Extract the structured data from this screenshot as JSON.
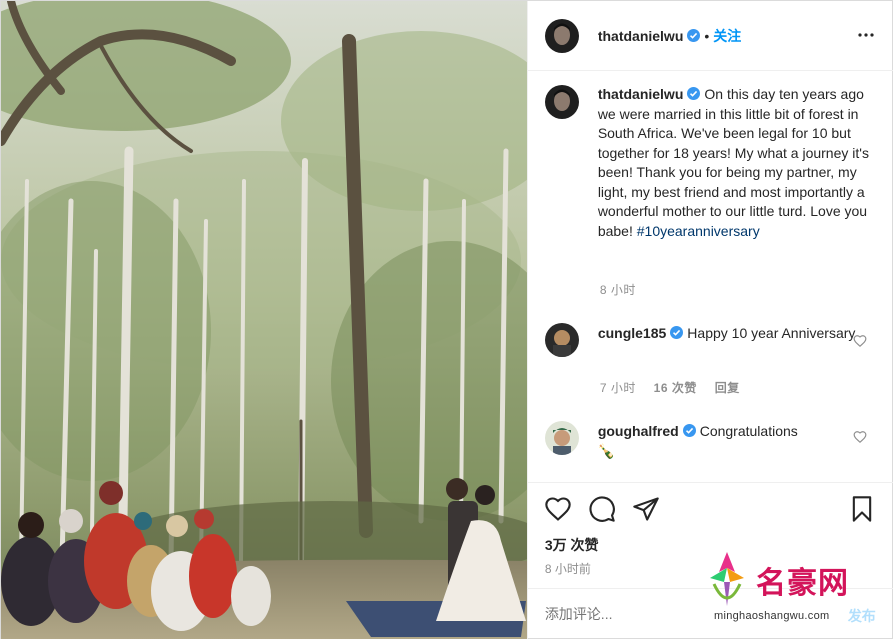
{
  "header": {
    "username": "thatdanielwu",
    "separator": "•",
    "follow_label": "关注"
  },
  "caption": {
    "username": "thatdanielwu",
    "text": "On this day ten years ago we were married in this little bit of forest in South Africa. We've been legal for 10 but together for 18 years! My what a journey it's been! Thank you for being my partner, my light, my best friend and most importantly a wonderful mother to our little turd. Love you babe!",
    "hashtag": "#10yearanniversary",
    "time": "8 小时"
  },
  "comments": [
    {
      "username": "cungle185",
      "text": "Happy 10 year Anniversary",
      "time": "7 小时",
      "likes": "16 次赞",
      "reply": "回复"
    },
    {
      "username": "goughalfred",
      "text": "Congratulations",
      "emoji": "🍾"
    }
  ],
  "actions": {
    "likes": "3万 次赞",
    "time": "8 小时前",
    "add_comment_placeholder": "添加评论...",
    "post_label": "发布"
  },
  "watermark": {
    "title": "名豪网",
    "url": "minghaoshangwu.com"
  },
  "colors": {
    "link": "#0095f6",
    "hashtag": "#00376b",
    "secondary_text": "#8e8e8e",
    "watermark_red": "#d3145a"
  }
}
